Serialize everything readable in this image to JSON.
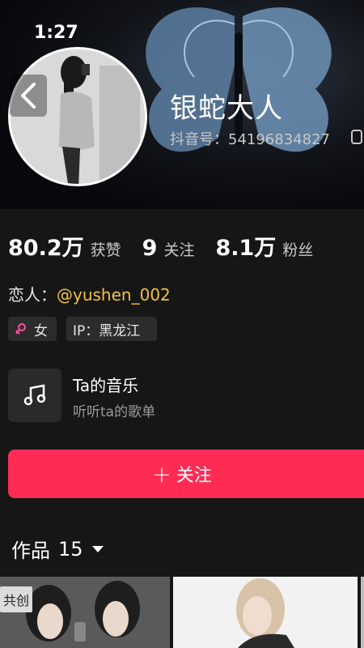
{
  "status_bar": {
    "time": "1:27"
  },
  "profile": {
    "name": "银蛇大人",
    "douyin_id": "抖音号：54196834827"
  },
  "stats": [
    {
      "value": "80.2万",
      "label": "获赞"
    },
    {
      "value": "9",
      "label": "关注"
    },
    {
      "value": "8.1万",
      "label": "粉丝"
    }
  ],
  "relationship": {
    "prefix": "恋人：",
    "handle": "@yushen_002"
  },
  "tags": {
    "gender": "女",
    "ip": "IP：黑龙江"
  },
  "music": {
    "title": "Ta的音乐",
    "subtitle": "听听ta的歌单"
  },
  "follow_button": {
    "plus": "+",
    "label": "关注"
  },
  "works": {
    "label": "作品",
    "count": "15"
  },
  "grid": {
    "badge": "共创"
  },
  "colors": {
    "accent": "#fe2c55",
    "link": "#f1c142",
    "background": "#161616"
  },
  "icons": [
    "back-arrow-icon",
    "copy-icon",
    "female-icon",
    "music-note-icon",
    "plus-icon",
    "caret-down-icon"
  ]
}
